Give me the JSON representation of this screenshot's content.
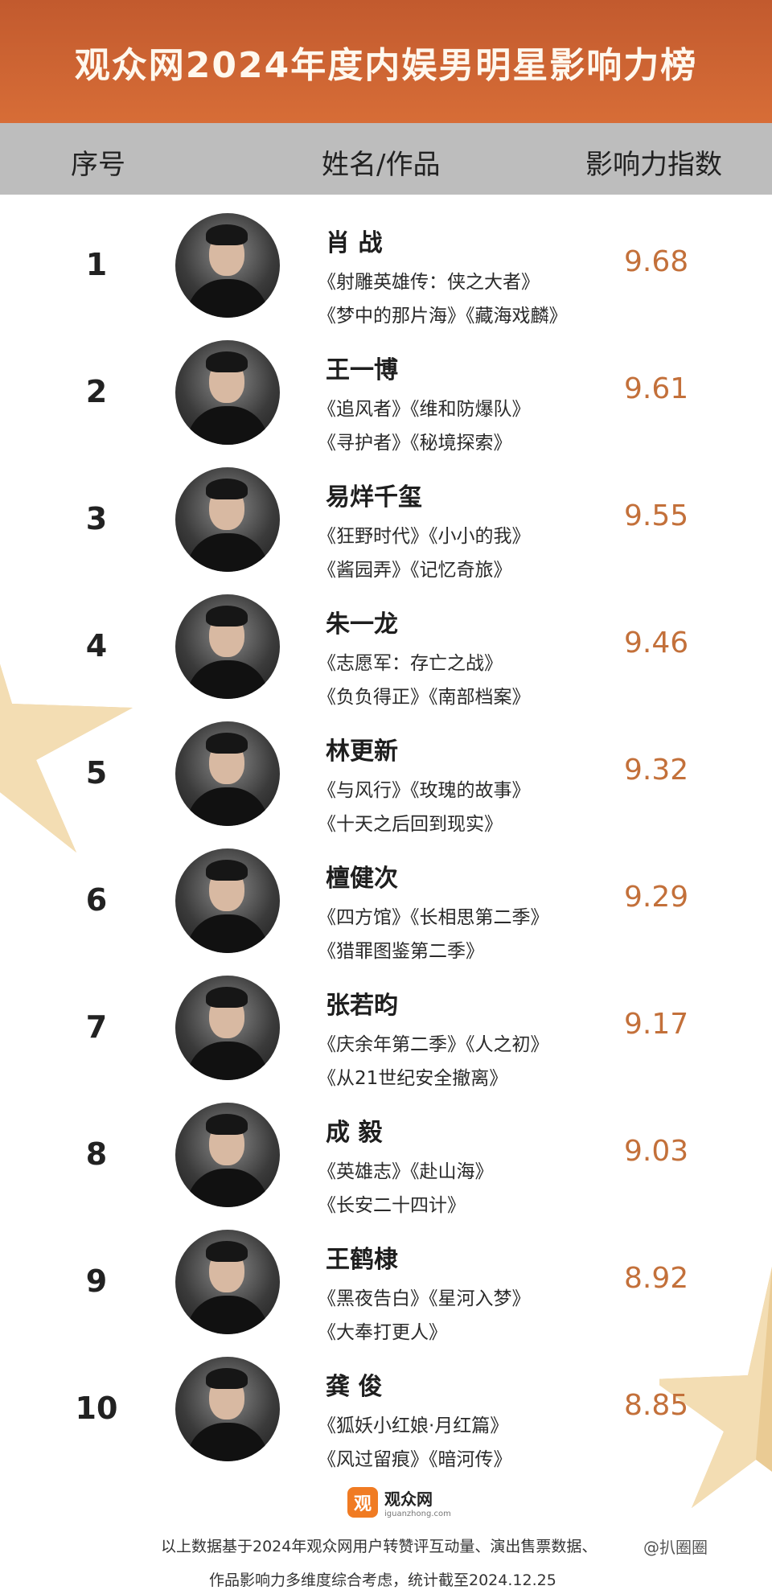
{
  "title": "观众网2024年度内娱男明星影响力榜",
  "columns": {
    "rank": "序号",
    "name": "姓名/作品",
    "score": "影响力指数"
  },
  "rows": [
    {
      "rank": "1",
      "name": "肖 战",
      "works1": "《射雕英雄传：侠之大者》",
      "works2": "《梦中的那片海》《藏海戏麟》",
      "score": "9.68"
    },
    {
      "rank": "2",
      "name": "王一博",
      "works1": "《追风者》《维和防爆队》",
      "works2": "《寻护者》《秘境探索》",
      "score": "9.61"
    },
    {
      "rank": "3",
      "name": "易烊千玺",
      "works1": "《狂野时代》《小小的我》",
      "works2": "《酱园弄》《记忆奇旅》",
      "score": "9.55"
    },
    {
      "rank": "4",
      "name": "朱一龙",
      "works1": "《志愿军：存亡之战》",
      "works2": "《负负得正》《南部档案》",
      "score": "9.46"
    },
    {
      "rank": "5",
      "name": "林更新",
      "works1": "《与风行》《玫瑰的故事》",
      "works2": "《十天之后回到现实》",
      "score": "9.32"
    },
    {
      "rank": "6",
      "name": "檀健次",
      "works1": "《四方馆》《长相思第二季》",
      "works2": "《猎罪图鉴第二季》",
      "score": "9.29"
    },
    {
      "rank": "7",
      "name": "张若昀",
      "works1": "《庆余年第二季》《人之初》",
      "works2": "《从21世纪安全撤离》",
      "score": "9.17"
    },
    {
      "rank": "8",
      "name": "成 毅",
      "works1": "《英雄志》《赴山海》",
      "works2": "《长安二十四计》",
      "score": "9.03"
    },
    {
      "rank": "9",
      "name": "王鹤棣",
      "works1": "《黑夜告白》《星河入梦》",
      "works2": "《大奉打更人》",
      "score": "8.92"
    },
    {
      "rank": "10",
      "name": "龚 俊",
      "works1": "《狐妖小红娘·月红篇》",
      "works2": "《风过留痕》《暗河传》",
      "score": "8.85"
    }
  ],
  "logo": {
    "icon": "观",
    "name": "观众网",
    "domain": "iguanzhong.com"
  },
  "footer": {
    "line1": "以上数据基于2024年观众网用户转赞评互动量、演出售票数据、",
    "line2": "作品影响力多维度综合考虑，统计截至2024.12.25"
  },
  "watermark": "@扒圈圈",
  "colors": {
    "header": "#c25a2e",
    "score": "#c3703a",
    "star": "#e9c68f"
  }
}
